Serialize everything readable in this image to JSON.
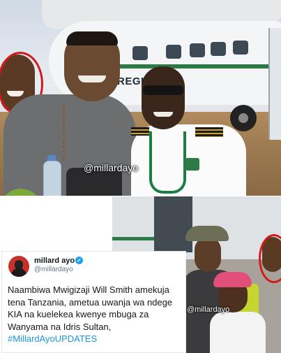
{
  "top_photo": {
    "plane_text": "REGIO   R",
    "watermark": "@millardayo"
  },
  "inset_photo": {
    "watermark": "@millardayo"
  },
  "tweet": {
    "name": "millard ayo",
    "verified_mark": "✓",
    "handle": "@millardayo",
    "text": "Naambiwa Mwigizaji Will Smith amekuja tena Tanzania, ametua uwanja wa ndege KIA na kuelekea kwenye mbuga za Wanyama na Idris Sultan, ",
    "hashtag": "#MillardAyoUPDATES",
    "avatar_icon": "person-avatar-icon",
    "verified_icon": "verified-badge-icon"
  },
  "colors": {
    "highlight_circle": "#d21a1a",
    "twitter_blue": "#1da1f2",
    "hashtag": "#1b95e0"
  }
}
